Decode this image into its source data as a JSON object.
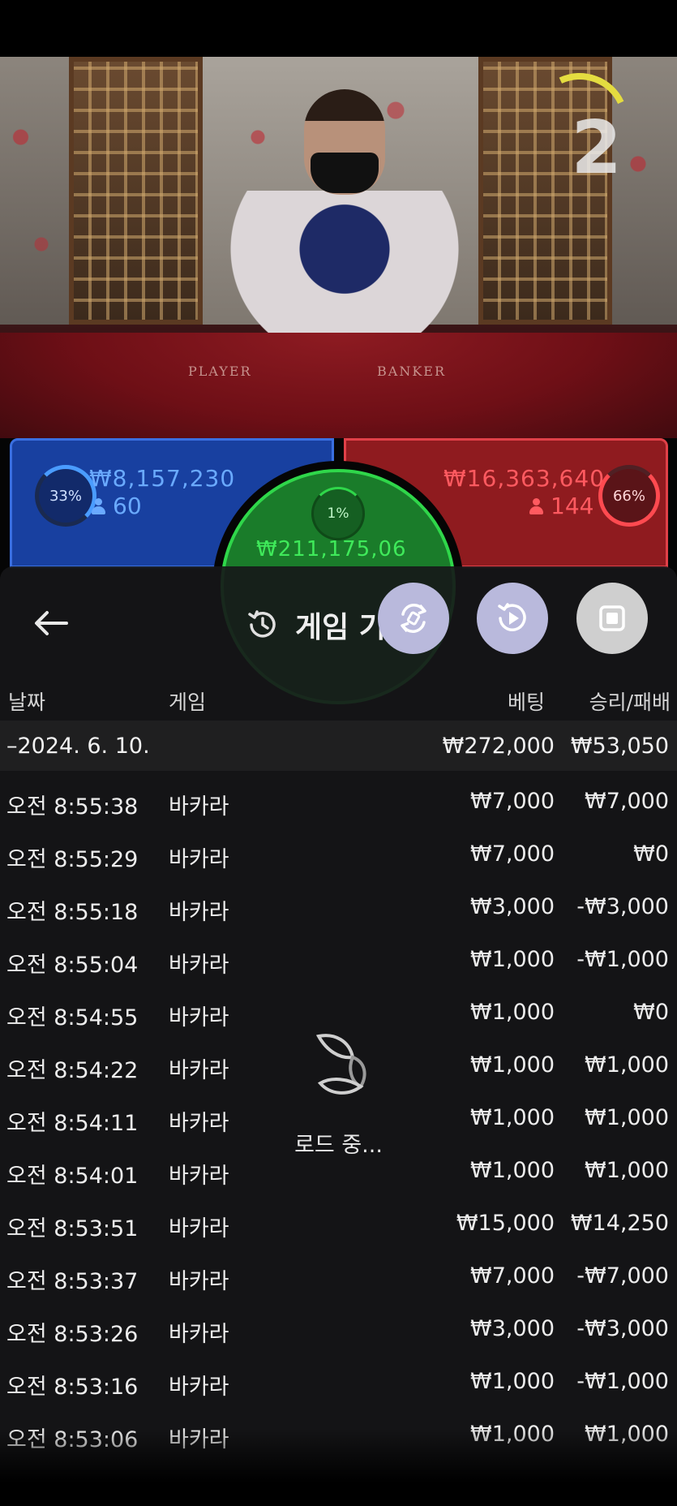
{
  "video": {
    "round_number": "2",
    "felt_player_label": "PLAYER",
    "felt_banker_label": "BANKER"
  },
  "board": {
    "player": {
      "percent": "33%",
      "amount": "₩8,157,230",
      "count": "60",
      "color": "#1840a0"
    },
    "banker": {
      "percent": "66%",
      "amount": "₩16,363,640",
      "count": "144",
      "color": "#8f1b1f"
    },
    "tie": {
      "percent": "1%",
      "amount": "₩211,175,06",
      "color": "#1a7c2a"
    }
  },
  "history": {
    "title": "게임 기",
    "back_icon": "arrow-left-icon",
    "title_icon": "history-clock-icon",
    "controls": [
      {
        "icon": "swap-rotate-icon"
      },
      {
        "icon": "replay-icon"
      },
      {
        "icon": "stop-icon"
      }
    ],
    "columns": {
      "date": "날짜",
      "game": "게임",
      "bet": "베팅",
      "win_loss": "승리/패배"
    },
    "day": {
      "date": "–2024. 6. 10.",
      "bet": "₩272,000",
      "win_loss": "₩53,050"
    },
    "rows": [
      {
        "time": "오전 8:55:38",
        "game": "바카라",
        "bet": "₩7,000",
        "win_loss": "₩7,000"
      },
      {
        "time": "오전 8:55:29",
        "game": "바카라",
        "bet": "₩7,000",
        "win_loss": "₩0"
      },
      {
        "time": "오전 8:55:18",
        "game": "바카라",
        "bet": "₩3,000",
        "win_loss": "-₩3,000"
      },
      {
        "time": "오전 8:55:04",
        "game": "바카라",
        "bet": "₩1,000",
        "win_loss": "-₩1,000"
      },
      {
        "time": "오전 8:54:55",
        "game": "바카라",
        "bet": "₩1,000",
        "win_loss": "₩0"
      },
      {
        "time": "오전 8:54:22",
        "game": "바카라",
        "bet": "₩1,000",
        "win_loss": "₩1,000"
      },
      {
        "time": "오전 8:54:11",
        "game": "바카라",
        "bet": "₩1,000",
        "win_loss": "₩1,000"
      },
      {
        "time": "오전 8:54:01",
        "game": "바카라",
        "bet": "₩1,000",
        "win_loss": "₩1,000"
      },
      {
        "time": "오전 8:53:51",
        "game": "바카라",
        "bet": "₩15,000",
        "win_loss": "₩14,250"
      },
      {
        "time": "오전 8:53:37",
        "game": "바카라",
        "bet": "₩7,000",
        "win_loss": "-₩7,000"
      },
      {
        "time": "오전 8:53:26",
        "game": "바카라",
        "bet": "₩3,000",
        "win_loss": "-₩3,000"
      },
      {
        "time": "오전 8:53:16",
        "game": "바카라",
        "bet": "₩1,000",
        "win_loss": "-₩1,000"
      },
      {
        "time": "오전 8:53:06",
        "game": "바카라",
        "bet": "₩1,000",
        "win_loss": "₩1,000"
      }
    ],
    "loading_text": "로드 중..."
  }
}
